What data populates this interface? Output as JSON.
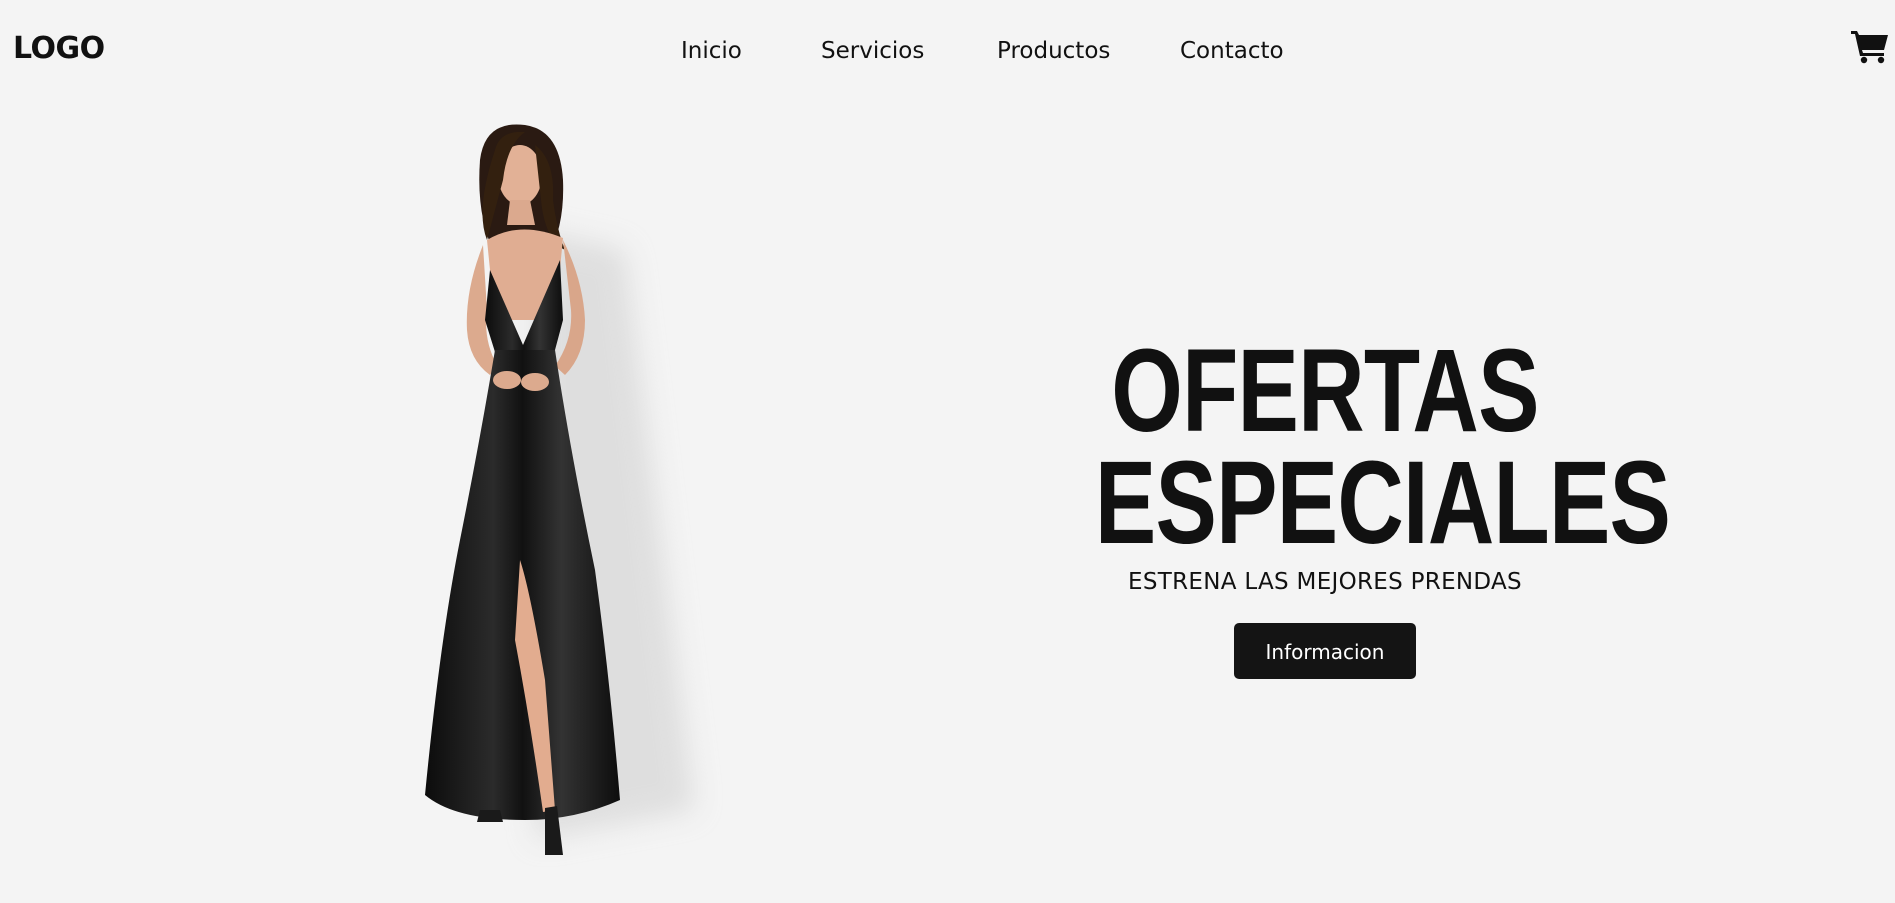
{
  "header": {
    "logo": "LOGO",
    "nav": [
      {
        "label": "Inicio"
      },
      {
        "label": "Servicios"
      },
      {
        "label": "Productos"
      },
      {
        "label": "Contacto"
      }
    ],
    "cart_icon": "shopping-cart-icon"
  },
  "hero": {
    "headline_line1": "OFERTAS",
    "headline_line2": "ESPECIALES",
    "subheadline": "ESTRENA LAS MEJORES PRENDAS",
    "button_label": "Informacion",
    "image": "woman-black-satin-dress"
  },
  "colors": {
    "background": "#f4f4f4",
    "text": "#111111",
    "button_bg": "#141414",
    "button_text": "#ffffff"
  }
}
